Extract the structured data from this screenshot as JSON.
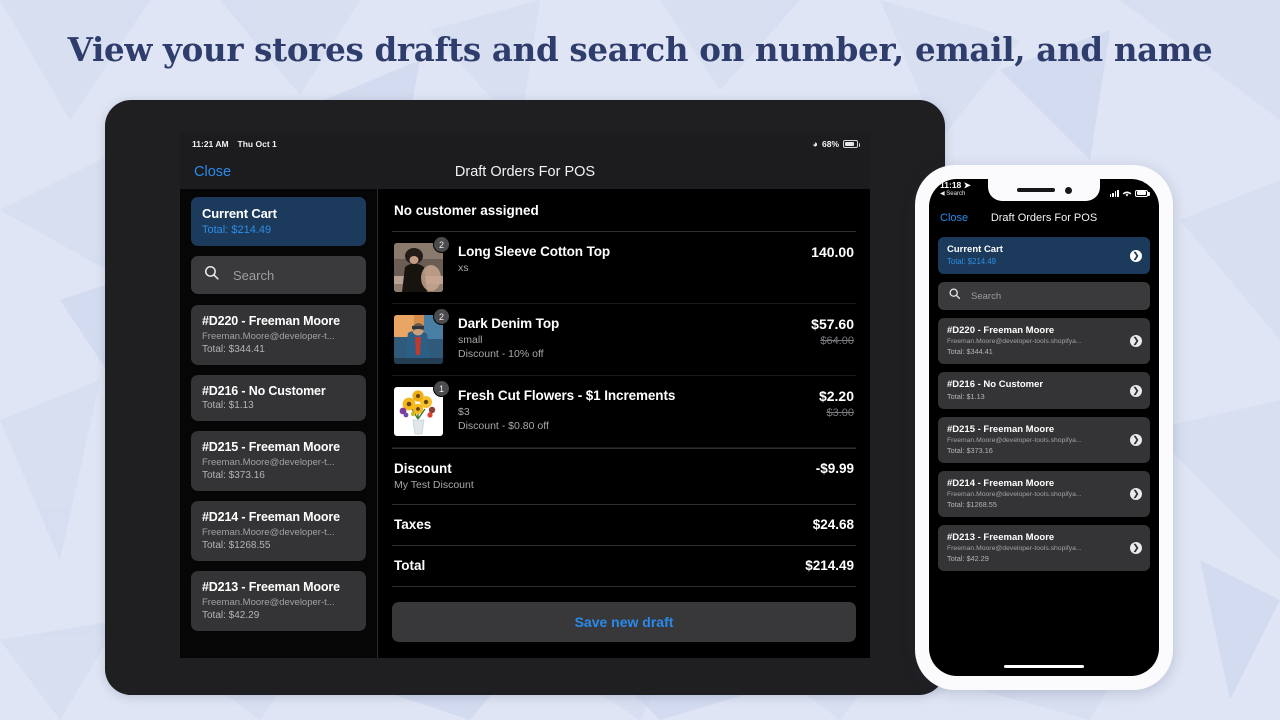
{
  "headline": "View your stores drafts and search on number, email, and name",
  "theme": {
    "page_bg": "#dfe5f4",
    "headline_color": "#2f3d6d",
    "accent_blue": "#2a8aeb",
    "cart_card_bg": "#1b3a5c",
    "draft_card_bg": "#343436",
    "screen_bg": "#000000"
  },
  "tablet": {
    "status_bar": {
      "time": "11:21 AM",
      "date": "Thu Oct 1",
      "wifi_icon": "wifi-icon",
      "battery_percent": "68%",
      "battery_icon": "battery-icon"
    },
    "nav": {
      "close_label": "Close",
      "title": "Draft Orders For POS"
    },
    "sidebar": {
      "current_cart": {
        "title": "Current Cart",
        "total": "Total: $214.49"
      },
      "search": {
        "placeholder": "Search",
        "icon": "search-icon"
      },
      "drafts": [
        {
          "title": "#D220 - Freeman Moore",
          "email": "Freeman.Moore@developer-t...",
          "total": "Total: $344.41"
        },
        {
          "title": "#D216 - No Customer",
          "email": "",
          "total": "Total: $1.13"
        },
        {
          "title": "#D215 - Freeman Moore",
          "email": "Freeman.Moore@developer-t...",
          "total": "Total: $373.16"
        },
        {
          "title": "#D214 - Freeman Moore",
          "email": "Freeman.Moore@developer-t...",
          "total": "Total: $1268.55"
        },
        {
          "title": "#D213 - Freeman Moore",
          "email": "Freeman.Moore@developer-t...",
          "total": "Total: $42.29"
        }
      ]
    },
    "main": {
      "customer_header": "No customer assigned",
      "line_items": [
        {
          "name": "Long Sleeve Cotton Top",
          "variant": "xs",
          "discount": "",
          "qty": "2",
          "price": "140.00",
          "compare_at": "",
          "thumb": "woman-black-top-photo"
        },
        {
          "name": "Dark Denim Top",
          "variant": "small",
          "discount": "Discount - 10% off",
          "qty": "2",
          "price": "$57.60",
          "compare_at": "$64.00",
          "thumb": "person-denim-jacket-photo"
        },
        {
          "name": "Fresh Cut Flowers - $1 Increments",
          "variant": "$3",
          "discount": "Discount - $0.80 off",
          "qty": "1",
          "price": "$2.20",
          "compare_at": "$3.00",
          "thumb": "sunflower-bouquet-photo"
        }
      ],
      "summary": [
        {
          "label": "Discount",
          "note": "My Test Discount",
          "value": "-$9.99"
        },
        {
          "label": "Taxes",
          "note": "",
          "value": "$24.68"
        },
        {
          "label": "Total",
          "note": "",
          "value": "$214.49"
        }
      ],
      "save_button": "Save new draft"
    }
  },
  "phone": {
    "status_bar": {
      "time": "11:18",
      "location_icon": "location-arrow-icon",
      "back_app": "Search",
      "signal_icon": "cellular-bars-icon",
      "wifi_icon": "wifi-icon",
      "battery_icon": "battery-icon"
    },
    "nav": {
      "close_label": "Close",
      "title": "Draft Orders For POS"
    },
    "current_cart": {
      "title": "Current Cart",
      "total": "Total: $214.49"
    },
    "search": {
      "placeholder": "Search",
      "icon": "search-icon"
    },
    "drafts": [
      {
        "title": "#D220 - Freeman Moore",
        "email": "Freeman.Moore@developer-tools.shopifya...",
        "total": "Total: $344.41"
      },
      {
        "title": "#D216 - No Customer",
        "email": "",
        "total": "Total: $1.13"
      },
      {
        "title": "#D215 - Freeman Moore",
        "email": "Freeman.Moore@developer-tools.shopifya...",
        "total": "Total: $373.16"
      },
      {
        "title": "#D214 - Freeman Moore",
        "email": "Freeman.Moore@developer-tools.shopifya...",
        "total": "Total: $1268.55"
      },
      {
        "title": "#D213 - Freeman Moore",
        "email": "Freeman.Moore@developer-tools.shopifya...",
        "total": "Total: $42.29"
      }
    ]
  }
}
